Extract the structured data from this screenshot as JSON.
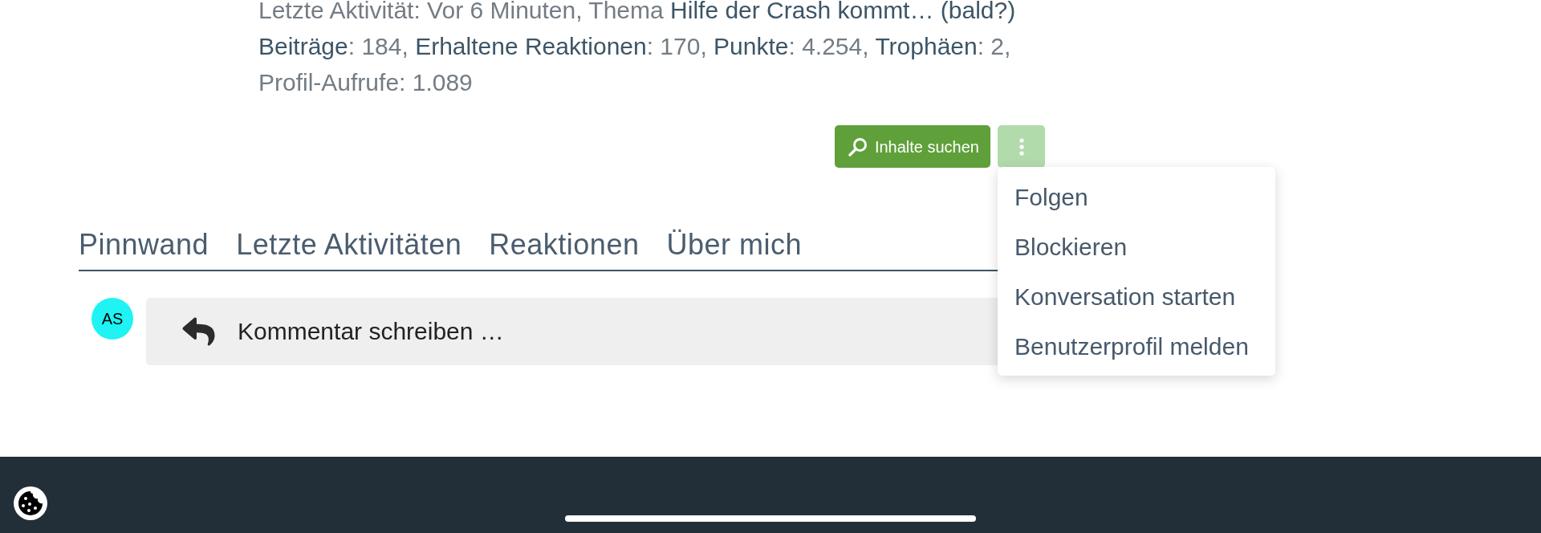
{
  "profile_info": {
    "activity_line": [
      {
        "kind": "plain",
        "text": "Letzte Aktivität: Vor 6 Minuten, Thema "
      },
      {
        "kind": "link",
        "text": "Hilfe der Crash kommt… (bald?)"
      }
    ],
    "stats_line": [
      {
        "kind": "link",
        "text": "Beiträge"
      },
      {
        "kind": "plain",
        "text": ": 184, "
      },
      {
        "kind": "link",
        "text": "Erhaltene Reaktionen"
      },
      {
        "kind": "plain",
        "text": ": 170, "
      },
      {
        "kind": "link",
        "text": "Punkte"
      },
      {
        "kind": "plain",
        "text": ": 4.254, "
      },
      {
        "kind": "link",
        "text": "Trophäen"
      },
      {
        "kind": "plain",
        "text": ": 2, Profil-Aufrufe: 1.089"
      }
    ]
  },
  "actions": {
    "search_button": {
      "label": "Inhalte suchen"
    },
    "more_menu": {
      "expanded": true,
      "items": [
        "Folgen",
        "Blockieren",
        "Konversation starten",
        "Benutzerprofil melden"
      ]
    }
  },
  "tabs": [
    "Pinnwand",
    "Letzte Aktivitäten",
    "Reaktionen",
    "Über mich"
  ],
  "comment": {
    "avatar": {
      "initials": "AS"
    },
    "placeholder": "Kommentar schreiben …"
  }
}
